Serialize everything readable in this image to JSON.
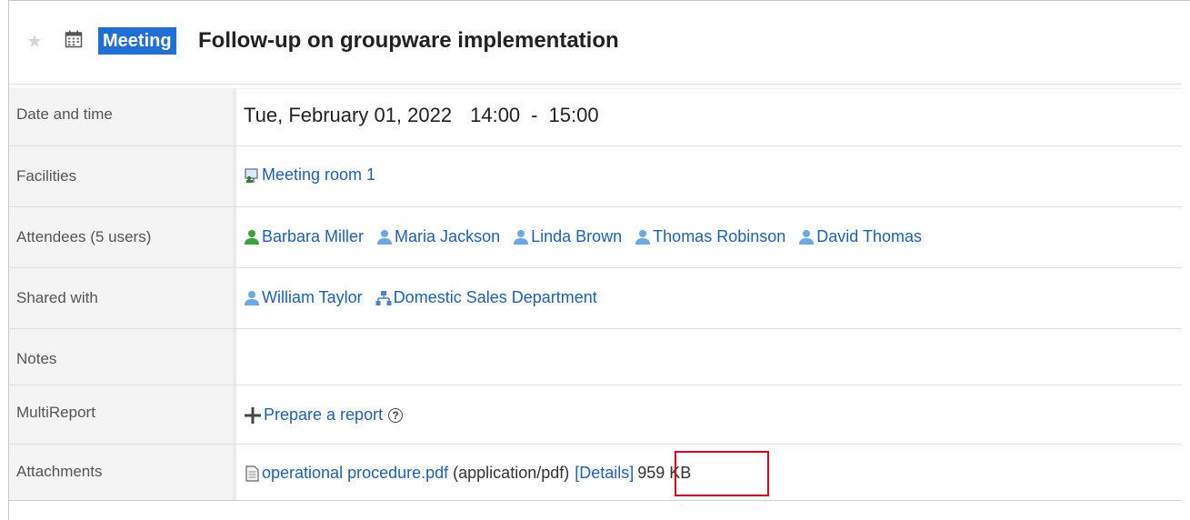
{
  "event": {
    "badge": "Meeting",
    "title": "Follow-up on groupware implementation"
  },
  "rows": {
    "datetime": {
      "label": "Date and time",
      "date": "Tue, February 01, 2022",
      "start": "14:00",
      "sep": "-",
      "end": "15:00"
    },
    "facilities": {
      "label": "Facilities",
      "items": [
        "Meeting room 1"
      ]
    },
    "attendees": {
      "label": "Attendees (5 users)",
      "items": [
        "Barbara Miller",
        "Maria Jackson",
        "Linda Brown",
        "Thomas Robinson",
        "David Thomas"
      ]
    },
    "shared": {
      "label": "Shared with",
      "user": "William Taylor",
      "group": "Domestic Sales Department"
    },
    "notes": {
      "label": "Notes",
      "value": ""
    },
    "multireport": {
      "label": "MultiReport",
      "action": "Prepare a report",
      "help": "?"
    },
    "attachments": {
      "label": "Attachments",
      "file": "operational procedure.pdf",
      "type": "(application/pdf)",
      "details": "[Details]",
      "size": "959 KB"
    }
  },
  "colors": {
    "badge_bg": "#1f6fd6",
    "link": "#1a62b8",
    "highlight": "#e0001b",
    "user_green": "#3aa33a",
    "user_blue": "#6aa8e6"
  },
  "icons": {
    "star": "star-icon",
    "calendar": "calendar-icon",
    "facility": "facility-icon",
    "user": "user-icon",
    "group": "organization-icon",
    "add": "plus-icon",
    "file": "file-icon",
    "help": "help-icon"
  }
}
